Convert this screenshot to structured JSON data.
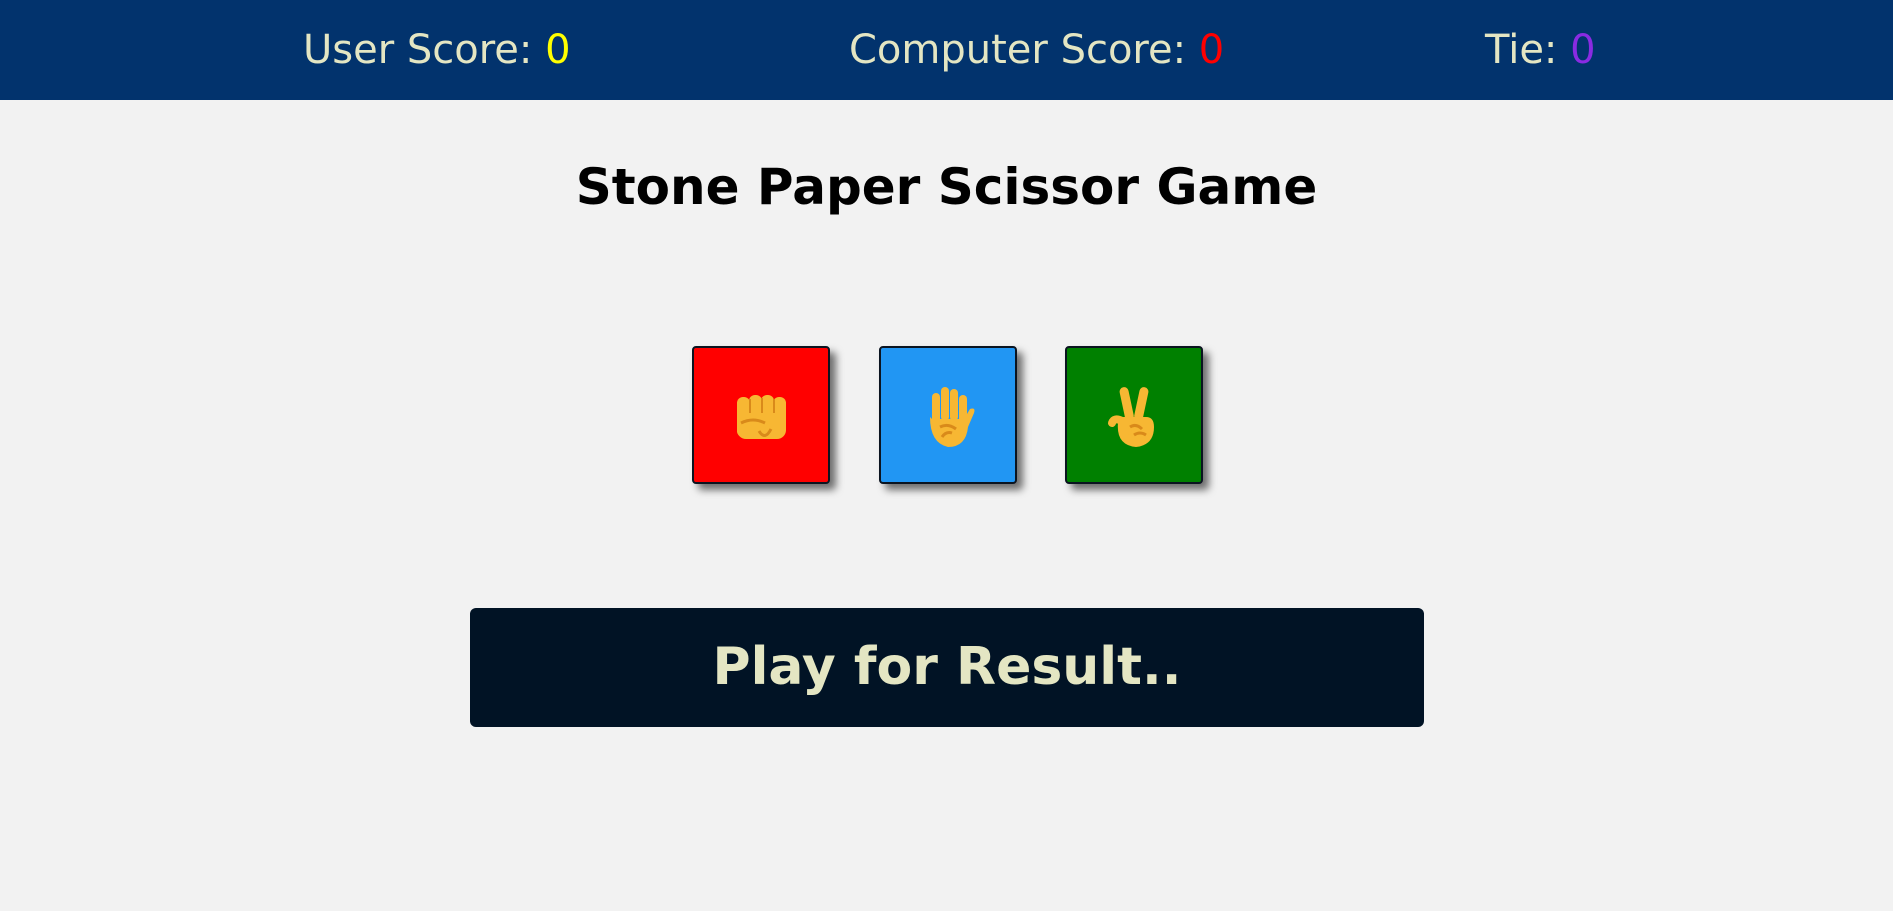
{
  "scores": {
    "user_label": "User Score: ",
    "user_value": "0",
    "user_value_color": "#ffff00",
    "computer_label": "Computer Score: ",
    "computer_value": "0",
    "computer_value_color": "#ff0000",
    "tie_label": "Tie: ",
    "tie_value": "0",
    "tie_value_color": "#8a2be2"
  },
  "title": "Stone Paper Scissor Game",
  "choices": [
    {
      "name": "stone",
      "icon": "fist-icon",
      "color": "#ff0000"
    },
    {
      "name": "paper",
      "icon": "raised-hand-icon",
      "color": "#2196f3"
    },
    {
      "name": "scissor",
      "icon": "victory-hand-icon",
      "color": "#008000"
    }
  ],
  "result_message": "Play for Result..",
  "colors": {
    "header_bg": "#02336d",
    "result_bg": "#011325",
    "text_light": "#e4e6c3",
    "page_bg": "#f2f2f2"
  }
}
